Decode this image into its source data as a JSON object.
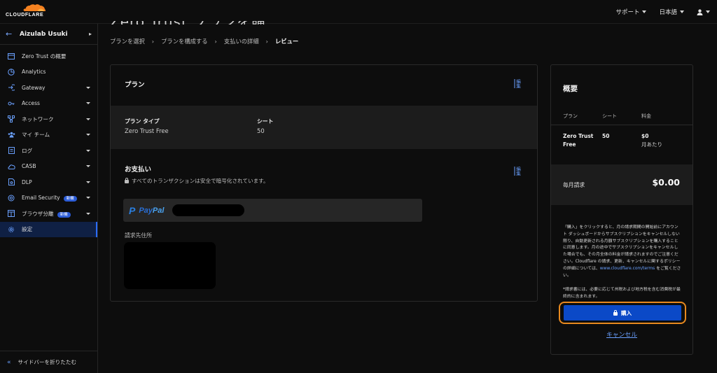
{
  "brand": {
    "logo_text": "CLOUDFLARE",
    "accent_orange": "#f48120"
  },
  "topbar": {
    "items": [
      {
        "label": "サポート"
      },
      {
        "label": "日本語"
      }
    ],
    "user_icon": "user-icon"
  },
  "sidebar": {
    "account_name": "Aizulab Usuki",
    "items": [
      {
        "label": "Zero Trust の概要",
        "icon": "overview-icon",
        "has_dropdown": false
      },
      {
        "label": "Analytics",
        "icon": "analytics-icon",
        "has_dropdown": false
      },
      {
        "label": "Gateway",
        "icon": "gateway-icon",
        "has_dropdown": true
      },
      {
        "label": "Access",
        "icon": "access-icon",
        "has_dropdown": true
      },
      {
        "label": "ネットワーク",
        "icon": "network-icon",
        "has_dropdown": true
      },
      {
        "label": "マイ チーム",
        "icon": "team-icon",
        "has_dropdown": true
      },
      {
        "label": "ログ",
        "icon": "logs-icon",
        "has_dropdown": true
      },
      {
        "label": "CASB",
        "icon": "casb-icon",
        "has_dropdown": true
      },
      {
        "label": "DLP",
        "icon": "dlp-icon",
        "has_dropdown": true
      },
      {
        "label": "Email Security",
        "icon": "email-icon",
        "has_dropdown": true,
        "badge": "新機"
      },
      {
        "label": "ブラウザ分離",
        "icon": "browser-icon",
        "has_dropdown": true,
        "badge": "新機"
      },
      {
        "label": "設定",
        "icon": "settings-icon",
        "has_dropdown": false,
        "active": true
      }
    ],
    "collapse_label": "サイドバーを折りたたむ"
  },
  "page": {
    "breadcrumb": [
      "プランを選択",
      "プランを構成する",
      "支払いの詳細",
      "レビュー"
    ]
  },
  "plan_card": {
    "title": "プラン",
    "edit_label": "編集",
    "plan_type_label": "プラン タイプ",
    "plan_type_value": "Zero Trust Free",
    "seats_label": "シート",
    "seats_value": "50",
    "payment_title": "お支払い",
    "payment_edit_label": "編集",
    "secure_note": "すべてのトランザクションは安全で暗号化されています。",
    "paypal_label_1": "Pay",
    "paypal_label_2": "Pal",
    "billing_address_label": "請求先住所"
  },
  "summary": {
    "title": "概要",
    "headers": {
      "plan": "プラン",
      "seats": "シート",
      "price": "料金"
    },
    "row": {
      "plan": "Zero Trust Free",
      "seats": "50",
      "price": "$0",
      "price_sub": "月あたり"
    },
    "monthly_label": "毎月請求",
    "monthly_value": "$0.00",
    "legal_text": "「購入」をクリックすると、月の請求期間の開始前にアカウント ダッシュボードからサブスクリプションをキャンセルしない限り、自動更新される月額サブスクリプションを購入することに同意します。月の途中でサブスクリプションをキャンセルした場合でも、その月全体の料金が請求されますのでご注意ください。Cloudflare の請求、更新、キャンセルに関するポリシーの詳細については、",
    "legal_link": "www.cloudflare.com/terms",
    "legal_tail": " をご覧ください。",
    "tax_note": "*請求書には、必要に応じて州税および地方税を含む消費税が最終的に含まれます。",
    "buy_label": "購入",
    "cancel_label": "キャンセル",
    "buy_color": "#0b49c7",
    "highlight_color": "#e8891f"
  }
}
